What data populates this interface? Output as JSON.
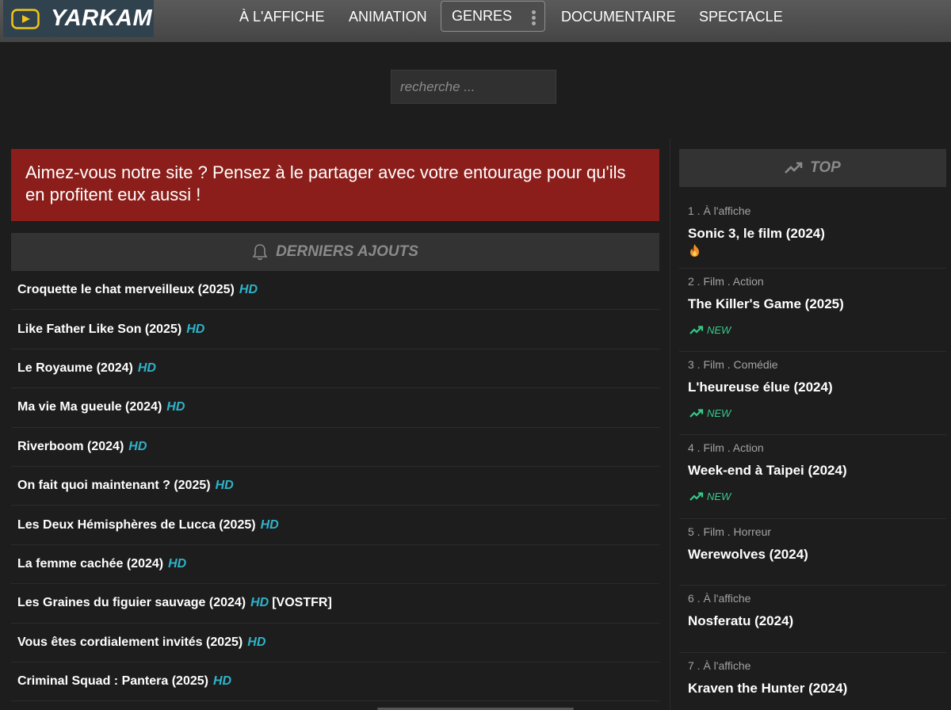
{
  "header": {
    "logo_text": "YARKAM",
    "nav": [
      "À L'AFFICHE",
      "ANIMATION",
      "GENRES",
      "DOCUMENTAIRE",
      "SPECTACLE"
    ]
  },
  "search": {
    "placeholder": "recherche ..."
  },
  "banner": {
    "text": "Aimez-vous notre site ? Pensez à le partager avec votre entourage pour qu'ils en profitent eux aussi !"
  },
  "latest": {
    "heading": "DERNIERS AJOUTS",
    "items": [
      {
        "title": "Croquette le chat merveilleux (2025)",
        "quality": "HD",
        "extra": ""
      },
      {
        "title": "Like Father Like Son (2025)",
        "quality": "HD",
        "extra": ""
      },
      {
        "title": "Le Royaume (2024)",
        "quality": "HD",
        "extra": ""
      },
      {
        "title": "Ma vie Ma gueule (2024)",
        "quality": "HD",
        "extra": ""
      },
      {
        "title": "Riverboom (2024)",
        "quality": "HD",
        "extra": ""
      },
      {
        "title": "On fait quoi maintenant ? (2025)",
        "quality": "HD",
        "extra": ""
      },
      {
        "title": "Les Deux Hémisphères de Lucca (2025)",
        "quality": "HD",
        "extra": ""
      },
      {
        "title": "La femme cachée (2024)",
        "quality": "HD",
        "extra": ""
      },
      {
        "title": "Les Graines du figuier sauvage (2024)",
        "quality": "HD",
        "extra": "[VOSTFR]"
      },
      {
        "title": "Vous êtes cordialement invités (2025)",
        "quality": "HD",
        "extra": ""
      },
      {
        "title": "Criminal Squad : Pantera (2025)",
        "quality": "HD",
        "extra": ""
      }
    ]
  },
  "top": {
    "heading": "TOP",
    "items": [
      {
        "meta": "1 . À l'affiche",
        "title": "Sonic 3, le film (2024)",
        "badge": "fire-icon"
      },
      {
        "meta": "2 . Film . Action",
        "title": "The Killer's Game (2025)",
        "badge": "NEW"
      },
      {
        "meta": "3 . Film . Comédie",
        "title": "L'heureuse élue (2024)",
        "badge": "NEW"
      },
      {
        "meta": "4 . Film . Action",
        "title": "Week-end à Taipei (2024)",
        "badge": "NEW"
      },
      {
        "meta": "5 . Film . Horreur",
        "title": "Werewolves (2024)",
        "badge": ""
      },
      {
        "meta": "6 . À l'affiche",
        "title": "Nosferatu (2024)",
        "badge": ""
      },
      {
        "meta": "7 . À l'affiche",
        "title": "Kraven the Hunter (2024)",
        "badge": ""
      }
    ]
  },
  "colors": {
    "accent_hd": "#2eb3c9",
    "banner": "#8b1e1a",
    "new": "#36c98b"
  }
}
